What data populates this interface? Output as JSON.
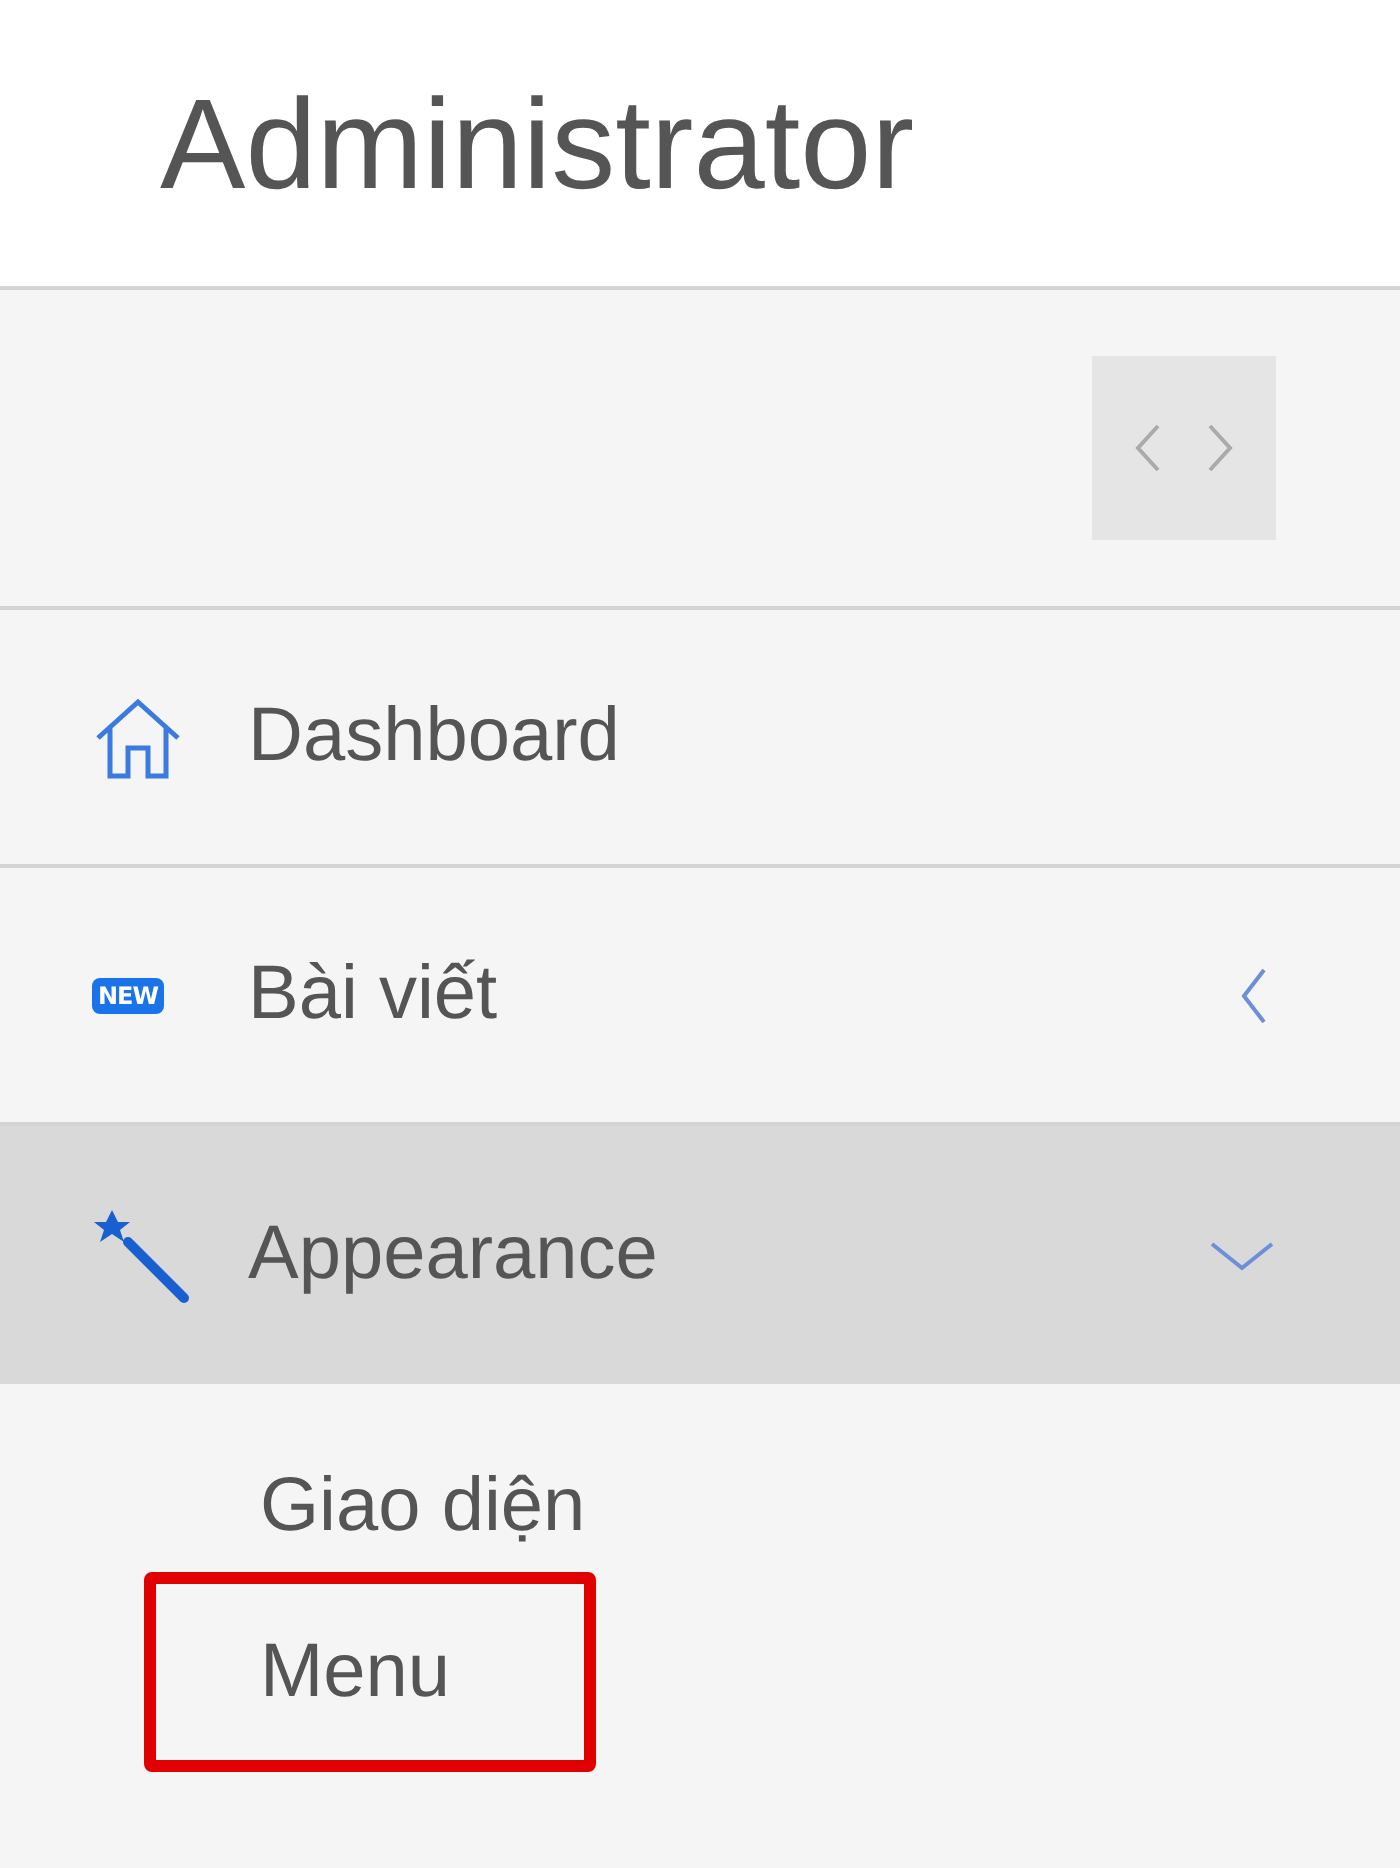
{
  "header": {
    "title": "Administrator"
  },
  "sidebar": {
    "items": [
      {
        "label": "Dashboard",
        "kind": "home"
      },
      {
        "label": "Bài viết",
        "kind": "new",
        "badge": "NEW",
        "expanded": false
      },
      {
        "label": "Appearance",
        "kind": "wand",
        "expanded": true,
        "children": [
          {
            "label": "Giao diện",
            "highlighted": false
          },
          {
            "label": "Menu",
            "highlighted": true
          }
        ]
      }
    ]
  }
}
